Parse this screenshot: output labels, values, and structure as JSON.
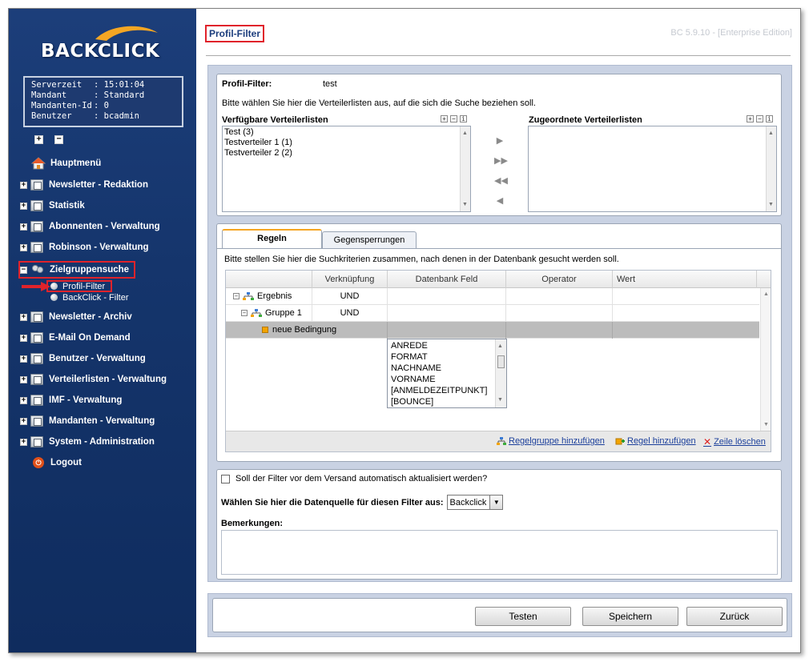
{
  "app": {
    "logo_text": "BACKCLICK",
    "version": "BC 5.9.10 - [Enterprise Edition]"
  },
  "session": [
    {
      "key": "Serverzeit",
      "value": ": 15:01:04"
    },
    {
      "key": "Mandant",
      "value": ": Standard"
    },
    {
      "key": "Mandanten-Id",
      "value": ": 0"
    },
    {
      "key": "Benutzer",
      "value": ": bcadmin"
    }
  ],
  "nav": {
    "expand_all": "+",
    "collapse_all": "−",
    "items": [
      {
        "label": "Hauptmenü"
      },
      {
        "label": "Newsletter - Redaktion"
      },
      {
        "label": "Statistik"
      },
      {
        "label": "Abonnenten - Verwaltung"
      },
      {
        "label": "Robinson - Verwaltung"
      },
      {
        "label": "Zielgruppensuche"
      },
      {
        "label": "Newsletter - Archiv"
      },
      {
        "label": "E-Mail On Demand"
      },
      {
        "label": "Benutzer - Verwaltung"
      },
      {
        "label": "Verteilerlisten - Verwaltung"
      },
      {
        "label": "IMF - Verwaltung"
      },
      {
        "label": "Mandanten - Verwaltung"
      },
      {
        "label": "System - Administration"
      },
      {
        "label": "Logout"
      }
    ],
    "sub_items": [
      {
        "label": "Profil-Filter"
      },
      {
        "label": "BackClick - Filter"
      }
    ]
  },
  "page": {
    "title": "Profil-Filter",
    "filter_label": "Profil-Filter:",
    "filter_name": "test",
    "instruction": "Bitte wählen Sie hier die Verteilerlisten aus, auf die sich die Suche beziehen soll.",
    "available_lists_title": "Verfügbare Verteilerlisten",
    "assigned_lists_title": "Zugeordnete Verteilerlisten",
    "available_lists": [
      "Test (3)",
      "Testverteiler 1 (1)",
      "Testverteiler 2 (2)"
    ],
    "assigned_lists": []
  },
  "rules": {
    "tabs": [
      {
        "label": "Regeln"
      },
      {
        "label": "Gegensperrungen"
      }
    ],
    "instruction": "Bitte stellen Sie hier die Suchkriterien zusammen, nach denen in der Datenbank gesucht werden soll.",
    "columns": [
      "Verknüpfung",
      "Datenbank Feld",
      "Operator",
      "Wert"
    ],
    "rows": [
      {
        "name": "Ergebnis",
        "link": "UND"
      },
      {
        "name": "Gruppe 1",
        "link": "UND"
      },
      {
        "name": "neue Bedingung",
        "link": ""
      }
    ],
    "field_options": [
      "ANREDE",
      "FORMAT",
      "NACHNAME",
      "VORNAME",
      "[ANMELDEZEITPUNKT]",
      "[BOUNCE]"
    ],
    "actions": {
      "add_group": "Regelgruppe hinzufügen",
      "add_rule": "Regel hinzufügen",
      "delete_row": "Zeile löschen"
    }
  },
  "options": {
    "auto_update_label": "Soll der Filter vor dem Versand automatisch aktualisiert werden?",
    "auto_update_checked": false,
    "datasource_label": "Wählen Sie hier die Datenquelle für diesen Filter aus:",
    "datasource_value": "Backclick",
    "remarks_label": "Bemerkungen:",
    "remarks_value": ""
  },
  "buttons": {
    "test": "Testen",
    "save": "Speichern",
    "back": "Zurück"
  },
  "colors": {
    "sidebar": "#15356c",
    "highlight": "#e0232b",
    "content_bg": "#c9d2e3",
    "link": "#1b3f9b"
  }
}
